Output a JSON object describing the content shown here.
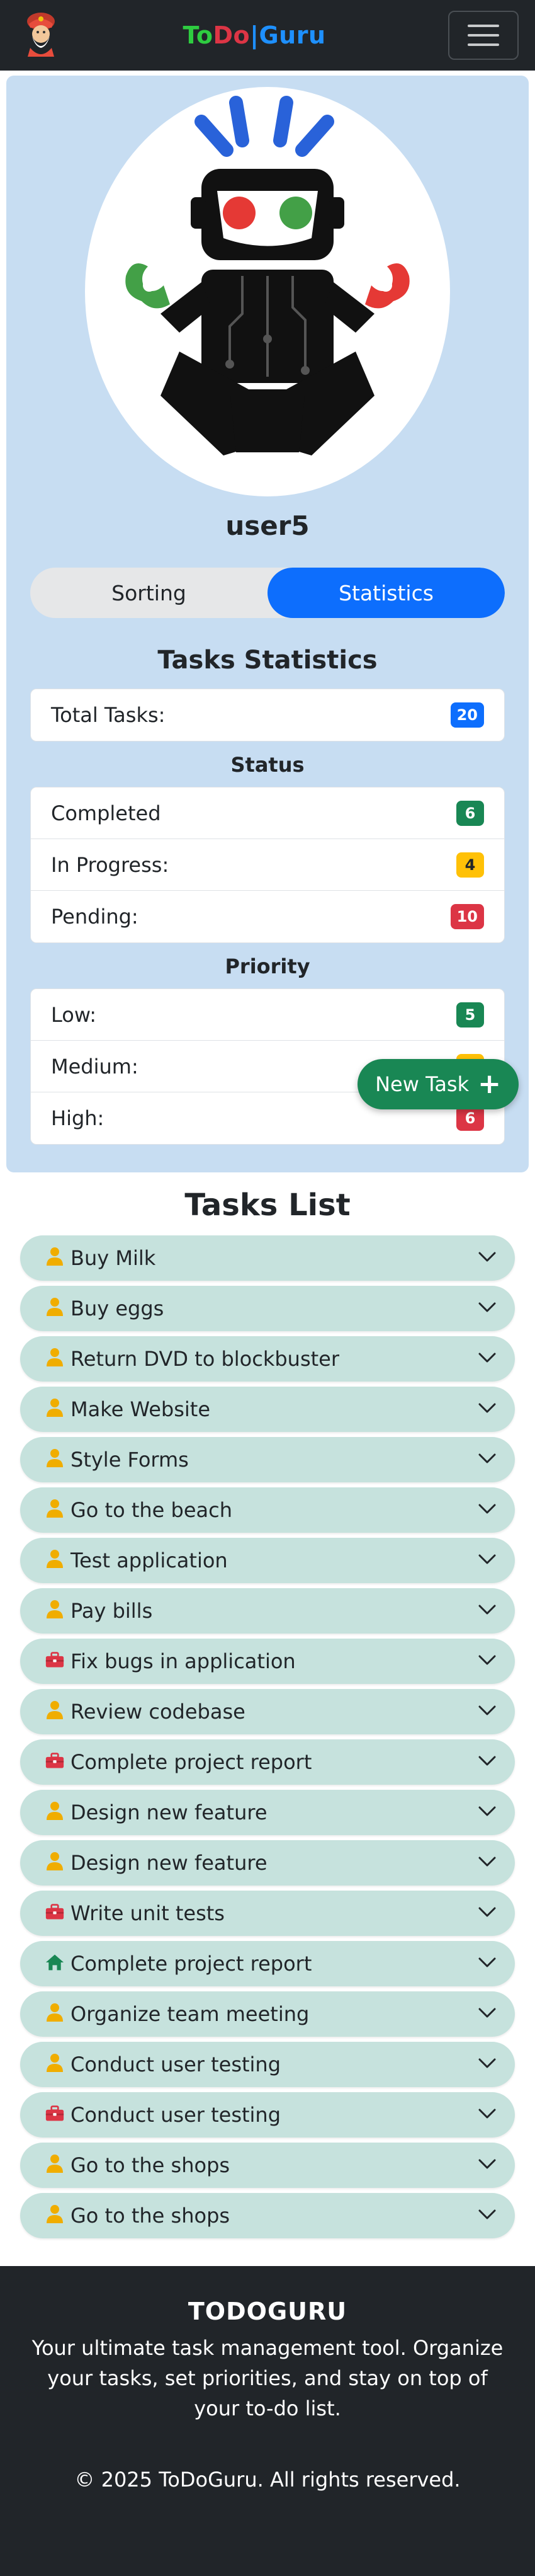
{
  "navbar": {
    "brand": {
      "part1": "To",
      "part2": "Do",
      "sep": "|",
      "part3": "Guru"
    },
    "avatar_icon": "guru-avatar-icon",
    "menu_icon": "hamburger-icon"
  },
  "profile": {
    "username": "user5",
    "robot_icon": "robot-avatar-icon"
  },
  "tabs": {
    "sorting": "Sorting",
    "statistics": "Statistics",
    "active": "statistics"
  },
  "stats": {
    "title": "Tasks Statistics",
    "total_label": "Total Tasks:",
    "total": "20",
    "status_title": "Status",
    "status": [
      {
        "label": "Completed",
        "count": "6",
        "color": "#198754"
      },
      {
        "label": "In Progress:",
        "count": "4",
        "color": "#ffc107"
      },
      {
        "label": "Pending:",
        "count": "10",
        "color": "#dc3545"
      }
    ],
    "priority_title": "Priority",
    "priority": [
      {
        "label": "Low:",
        "count": "5",
        "color": "#198754"
      },
      {
        "label": "Medium:",
        "count": "",
        "color": "#ffc107"
      },
      {
        "label": "High:",
        "count": "6",
        "color": "#dc3545"
      }
    ]
  },
  "fab": {
    "label": "New Task",
    "icon": "plus-icon"
  },
  "task_list": {
    "title": "Tasks List",
    "items": [
      {
        "name": "Buy Milk",
        "category": "person-icon"
      },
      {
        "name": "Buy eggs",
        "category": "person-icon"
      },
      {
        "name": "Return DVD to blockbuster",
        "category": "person-icon"
      },
      {
        "name": "Make Website",
        "category": "person-icon"
      },
      {
        "name": "Style Forms",
        "category": "person-icon"
      },
      {
        "name": "Go to the beach",
        "category": "person-icon"
      },
      {
        "name": "Test application",
        "category": "person-icon"
      },
      {
        "name": "Pay bills",
        "category": "person-icon"
      },
      {
        "name": "Fix bugs in application",
        "category": "briefcase-icon"
      },
      {
        "name": "Review codebase",
        "category": "person-icon"
      },
      {
        "name": "Complete project report",
        "category": "briefcase-icon"
      },
      {
        "name": "Design new feature",
        "category": "person-icon"
      },
      {
        "name": "Design new feature",
        "category": "person-icon"
      },
      {
        "name": "Write unit tests",
        "category": "briefcase-icon"
      },
      {
        "name": "Complete project report",
        "category": "house-icon"
      },
      {
        "name": "Organize team meeting",
        "category": "person-icon"
      },
      {
        "name": "Conduct user testing",
        "category": "person-icon"
      },
      {
        "name": "Conduct user testing",
        "category": "briefcase-icon"
      },
      {
        "name": "Go to the shops",
        "category": "person-icon"
      },
      {
        "name": "Go to the shops",
        "category": "person-icon"
      }
    ]
  },
  "footer": {
    "title": "TODOGURU",
    "description": "Your ultimate task management tool. Organize your tasks, set priorities, and stay on top of your to-do list.",
    "copyright": "© 2025 ToDoGuru. All rights reserved."
  },
  "colors": {
    "navbar_bg": "#212529",
    "panel_bg": "#c7ddf2",
    "primary": "#0d6efd",
    "success": "#198754",
    "warning": "#ffc107",
    "danger": "#dc3545",
    "task_bg": "#c6e2dd",
    "icon_person": "#f0ad00",
    "icon_briefcase": "#dc3545",
    "icon_house": "#198754"
  }
}
